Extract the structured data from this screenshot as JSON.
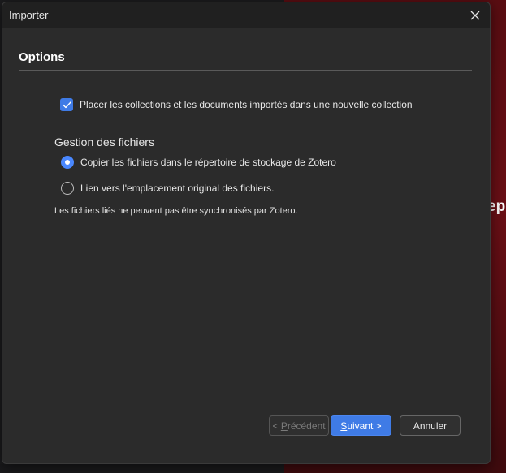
{
  "window": {
    "title": "Importer",
    "close_icon": "close-icon"
  },
  "section": {
    "title": "Options"
  },
  "options": {
    "new_collection_label": "Placer les collections et les documents importés dans une nouvelle collection",
    "new_collection_checked": true
  },
  "file_handling": {
    "label": "Gestion des fichiers",
    "copy_label": "Copier les fichiers dans le répertoire de stockage de Zotero",
    "copy_selected": true,
    "link_label": "Lien vers l'emplacement original des fichiers.",
    "link_selected": false,
    "note": "Les fichiers liés ne peuvent pas être synchronisés par Zotero."
  },
  "buttons": {
    "previous_prefix": "< ",
    "previous_accel": "P",
    "previous_rest": "récédent",
    "next_accel": "S",
    "next_rest": "uivant >",
    "cancel": "Annuler"
  },
  "background": {
    "partial_text": "epu"
  },
  "colors": {
    "accent": "#3f7be6",
    "dialog_bg": "#2b2b2b",
    "titlebar_bg": "#202020"
  }
}
